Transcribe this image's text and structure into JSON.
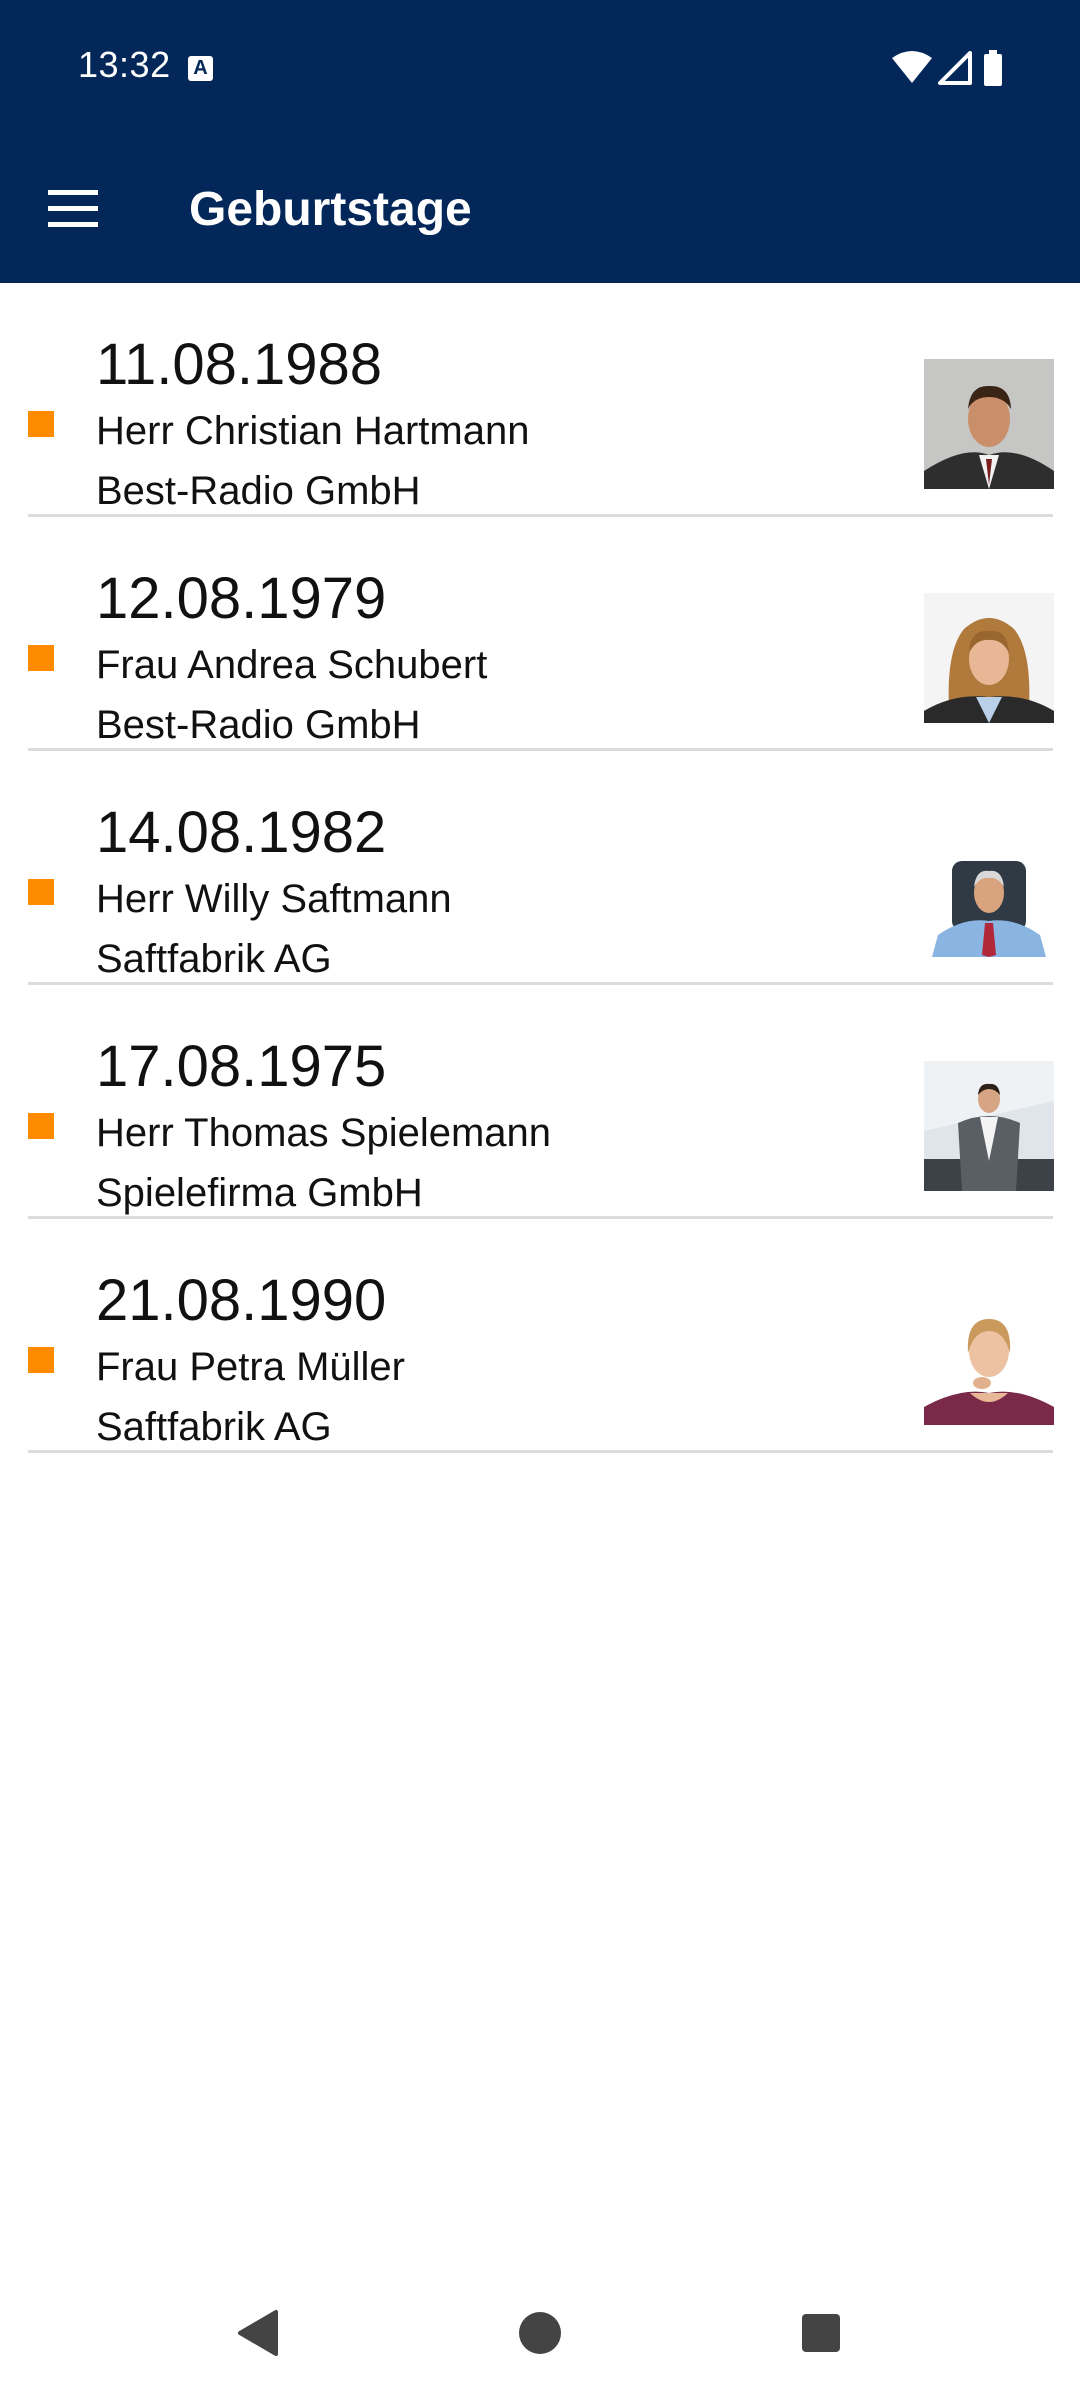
{
  "status_bar": {
    "time": "13:32",
    "notification_icon": "keyboard-a-icon",
    "icons": [
      "wifi-icon",
      "cell-signal-icon",
      "battery-icon"
    ]
  },
  "app_bar": {
    "title": "Geburtstage",
    "menu_icon": "hamburger-menu-icon"
  },
  "birthdays": [
    {
      "date": "11.08.1988",
      "name": "Herr Christian Hartmann",
      "company": "Best-Radio GmbH"
    },
    {
      "date": "12.08.1979",
      "name": "Frau Andrea Schubert",
      "company": "Best-Radio GmbH"
    },
    {
      "date": "14.08.1982",
      "name": "Herr Willy Saftmann",
      "company": "Saftfabrik AG"
    },
    {
      "date": "17.08.1975",
      "name": "Herr Thomas Spielemann",
      "company": "Spielefirma GmbH"
    },
    {
      "date": "21.08.1990",
      "name": "Frau Petra Müller",
      "company": "Saftfabrik AG"
    }
  ],
  "nav_bar": [
    "back-icon",
    "home-icon",
    "recents-icon"
  ],
  "colors": {
    "header": "#022758",
    "marker": "#ff8c00",
    "divider": "#dcdcdc"
  }
}
